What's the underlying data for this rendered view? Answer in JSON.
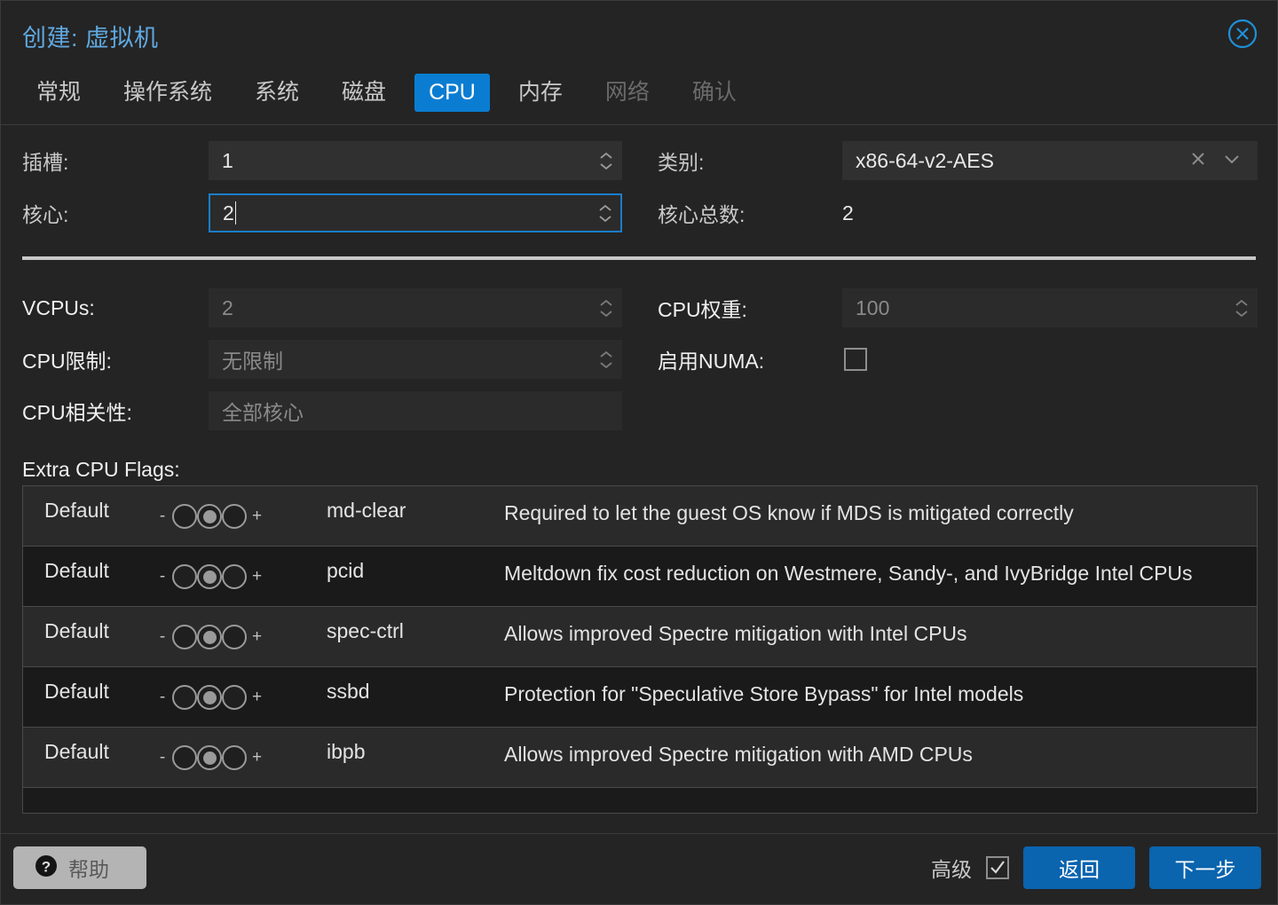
{
  "dialog": {
    "title": "创建: 虚拟机",
    "close_icon": "close-circle-icon"
  },
  "tabs": [
    {
      "label": "常规",
      "state": "normal"
    },
    {
      "label": "操作系统",
      "state": "normal"
    },
    {
      "label": "系统",
      "state": "normal"
    },
    {
      "label": "磁盘",
      "state": "normal"
    },
    {
      "label": "CPU",
      "state": "active"
    },
    {
      "label": "内存",
      "state": "normal"
    },
    {
      "label": "网络",
      "state": "disabled"
    },
    {
      "label": "确认",
      "state": "disabled"
    }
  ],
  "form": {
    "sockets": {
      "label": "插槽:",
      "value": "1"
    },
    "cores": {
      "label": "核心:",
      "value": "2"
    },
    "type": {
      "label": "类别:",
      "value": "x86-64-v2-AES"
    },
    "total": {
      "label": "核心总数:",
      "value": "2"
    },
    "vcpus": {
      "label": "VCPUs:",
      "value": "2"
    },
    "cpu_limit": {
      "label": "CPU限制:",
      "value": "无限制"
    },
    "affinity": {
      "label": "CPU相关性:",
      "value": "全部核心"
    },
    "cpu_units": {
      "label": "CPU权重:",
      "value": "100"
    },
    "numa": {
      "label": "启用NUMA:",
      "checked": false
    }
  },
  "flags": {
    "label": "Extra CPU Flags:",
    "rows": [
      {
        "state": "Default",
        "name": "md-clear",
        "description": "Required to let the guest OS know if MDS is mitigated correctly"
      },
      {
        "state": "Default",
        "name": "pcid",
        "description": "Meltdown fix cost reduction on Westmere, Sandy-, and IvyBridge Intel CPUs"
      },
      {
        "state": "Default",
        "name": "spec-ctrl",
        "description": "Allows improved Spectre mitigation with Intel CPUs"
      },
      {
        "state": "Default",
        "name": "ssbd",
        "description": "Protection for \"Speculative Store Bypass\" for Intel models"
      },
      {
        "state": "Default",
        "name": "ibpb",
        "description": "Allows improved Spectre mitigation with AMD CPUs"
      }
    ],
    "minus_sign": "-",
    "plus_sign": "+"
  },
  "footer": {
    "help_label": "帮助",
    "help_icon": "question-mark-circle-icon",
    "advanced_label": "高级",
    "advanced_checked": true,
    "back_label": "返回",
    "next_label": "下一步"
  },
  "colors": {
    "accent_tab": "#0a7dd2",
    "accent_button": "#0a64ae",
    "title": "#60a9e0",
    "focus_border": "#1a7ec8",
    "background": "#242424",
    "row_odd": "#2a2a2a",
    "row_even": "#1a1a1a"
  }
}
